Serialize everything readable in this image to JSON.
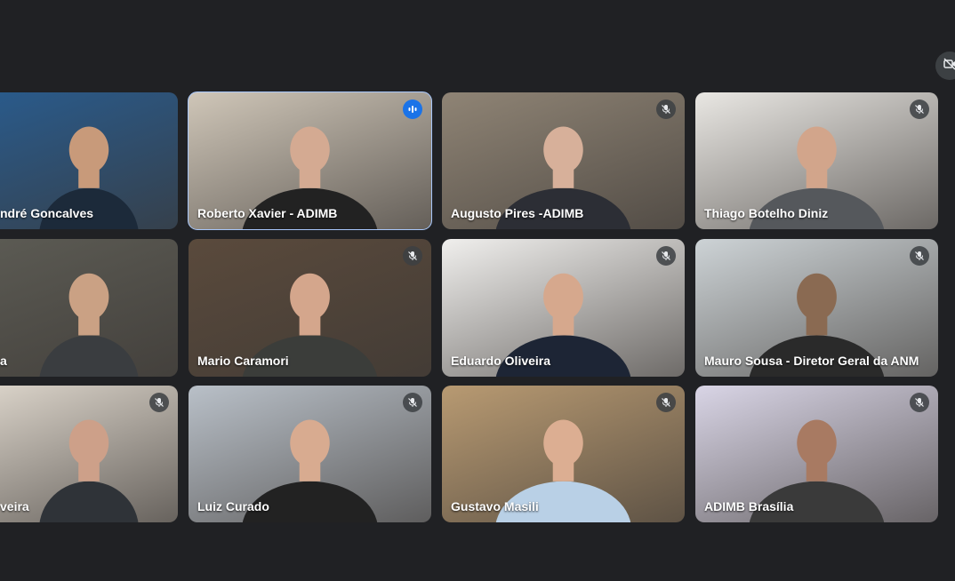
{
  "participants": [
    {
      "name": "ndré Goncalves",
      "muted": false,
      "speaking": false,
      "bg": "#2a5a8a",
      "skin": "#c89a7a",
      "shirt": "#1c2a3a"
    },
    {
      "name": "Roberto Xavier - ADIMB",
      "muted": false,
      "speaking": true,
      "bg": "#cfc6b8",
      "skin": "#d4aa92",
      "shirt": "#222222"
    },
    {
      "name": "Augusto Pires -ADIMB",
      "muted": true,
      "speaking": false,
      "bg": "#8f8475",
      "skin": "#d7b09a",
      "shirt": "#2c2e35"
    },
    {
      "name": "Thiago Botelho Diniz",
      "muted": true,
      "speaking": false,
      "bg": "#e9e7e3",
      "skin": "#d2a58b",
      "shirt": "#55585c"
    },
    {
      "name": "a",
      "muted": false,
      "speaking": false,
      "bg": "#5b5a53",
      "skin": "#caa184",
      "shirt": "#3a3d40"
    },
    {
      "name": "Mario Caramori",
      "muted": true,
      "speaking": false,
      "bg": "#5a4a3c",
      "skin": "#d4a68c",
      "shirt": "#3b3d3a"
    },
    {
      "name": "Eduardo Oliveira",
      "muted": true,
      "speaking": false,
      "bg": "#f0efed",
      "skin": "#d6a88d",
      "shirt": "#1d2535"
    },
    {
      "name": "Mauro Sousa - Diretor Geral da ANM",
      "muted": true,
      "speaking": false,
      "bg": "#cdd3d6",
      "skin": "#8a6a52",
      "shirt": "#2a2a2a"
    },
    {
      "name": "veira",
      "muted": true,
      "speaking": false,
      "bg": "#d8d1c7",
      "skin": "#cda089",
      "shirt": "#2f3338"
    },
    {
      "name": "Luiz Curado",
      "muted": true,
      "speaking": false,
      "bg": "#b9c0c8",
      "skin": "#d8ab90",
      "shirt": "#222222"
    },
    {
      "name": "Gustavo Masili",
      "muted": true,
      "speaking": false,
      "bg": "#b89a72",
      "skin": "#dcae92",
      "shirt": "#b9d0e6"
    },
    {
      "name": "ADIMB Brasília",
      "muted": true,
      "speaking": false,
      "bg": "#d9d5e6",
      "skin": "#a87a62",
      "shirt": "#3a3a3a"
    }
  ],
  "icons": {
    "muted": "mic-off-icon",
    "speaking": "audio-level-icon",
    "corner": "video-off-icon"
  }
}
